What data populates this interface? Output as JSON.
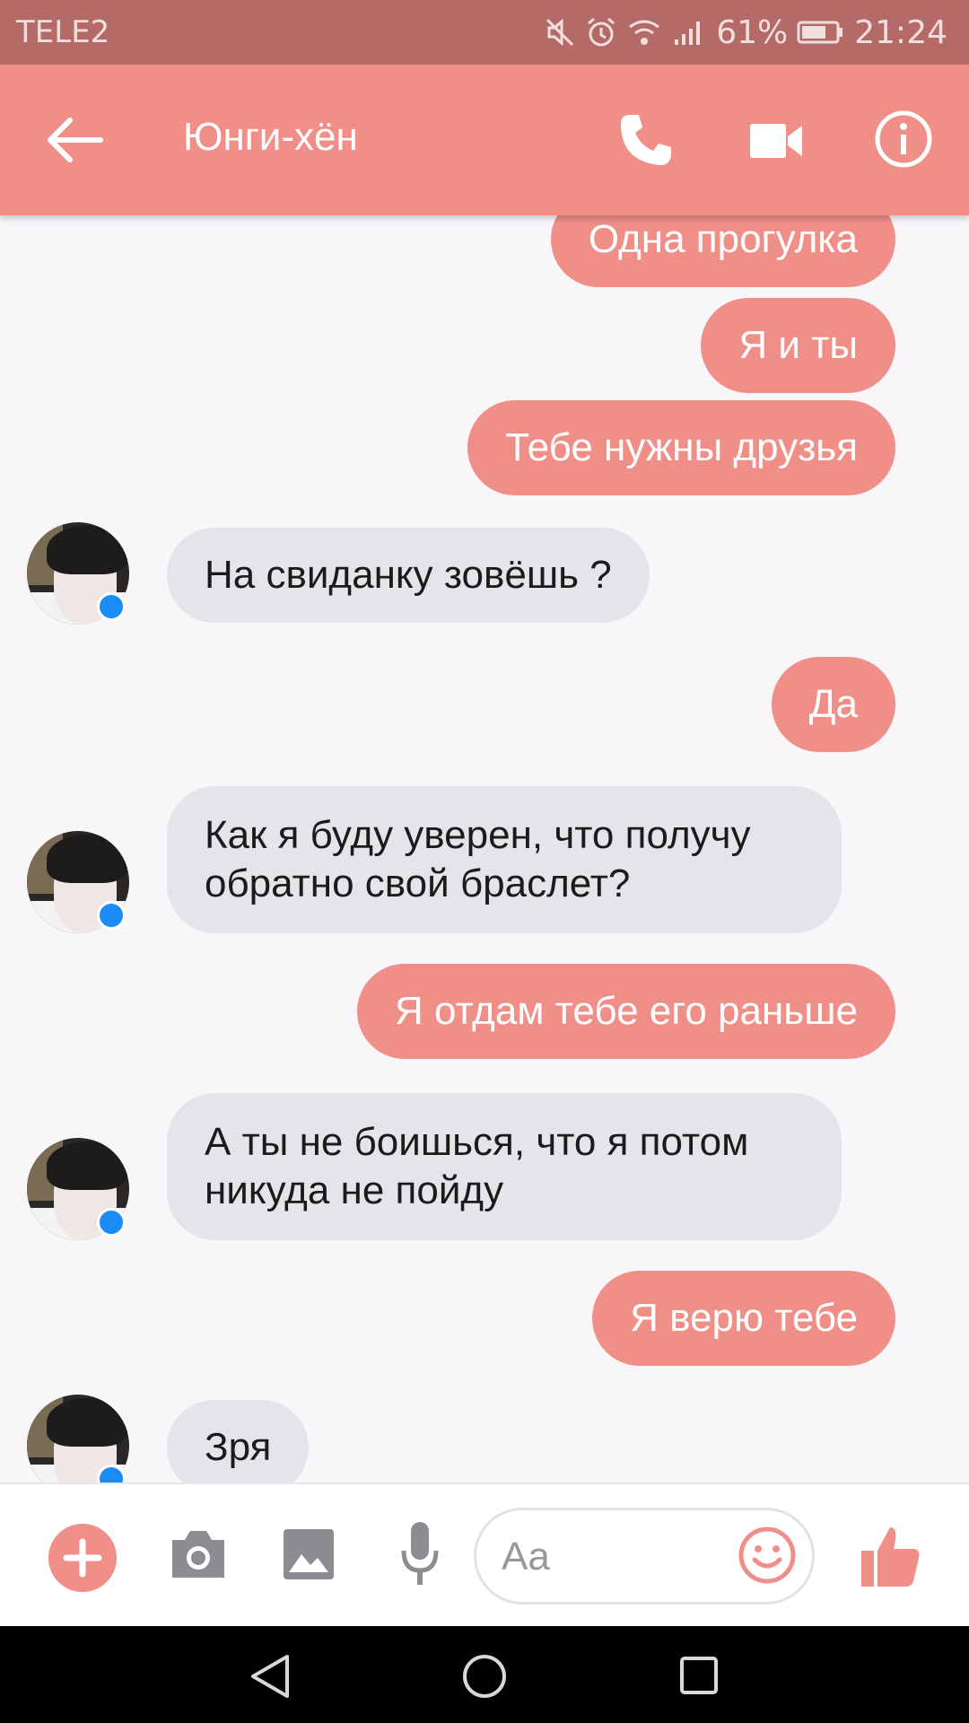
{
  "status_bar": {
    "carrier": "TELE2",
    "battery_percent": "61%",
    "time": "21:24",
    "icons": [
      "mute-icon",
      "alarm-icon",
      "wifi-icon",
      "signal-icon",
      "battery-icon"
    ]
  },
  "header": {
    "title": "Юнги-хён",
    "icons": [
      "back-arrow-icon",
      "phone-icon",
      "video-camera-icon",
      "info-icon"
    ]
  },
  "messages": [
    {
      "side": "out",
      "text": "Одна прогулка"
    },
    {
      "side": "out",
      "text": "Я и ты"
    },
    {
      "side": "out",
      "text": "Тебе нужны друзья"
    },
    {
      "side": "in",
      "text": "На свиданку зовёшь ?"
    },
    {
      "side": "out",
      "text": "Да"
    },
    {
      "side": "in",
      "text": "Как я буду уверен, что получу обратно свой браслет?"
    },
    {
      "side": "out",
      "text": "Я отдам тебе его раньше"
    },
    {
      "side": "in",
      "text": "А ты не боишься, что я потом никуда не пойду"
    },
    {
      "side": "out",
      "text": "Я верю тебе"
    },
    {
      "side": "in",
      "text": "Зря"
    }
  ],
  "composer": {
    "placeholder": "Aa",
    "icons": [
      "plus-icon",
      "camera-icon",
      "gallery-icon",
      "microphone-icon",
      "emoji-icon",
      "thumbs-up-icon"
    ]
  },
  "colors": {
    "accent": "#f08e88",
    "status_bar": "#b46a67",
    "incoming_bubble": "#e6e4e9",
    "background": "#f8f6f9"
  }
}
